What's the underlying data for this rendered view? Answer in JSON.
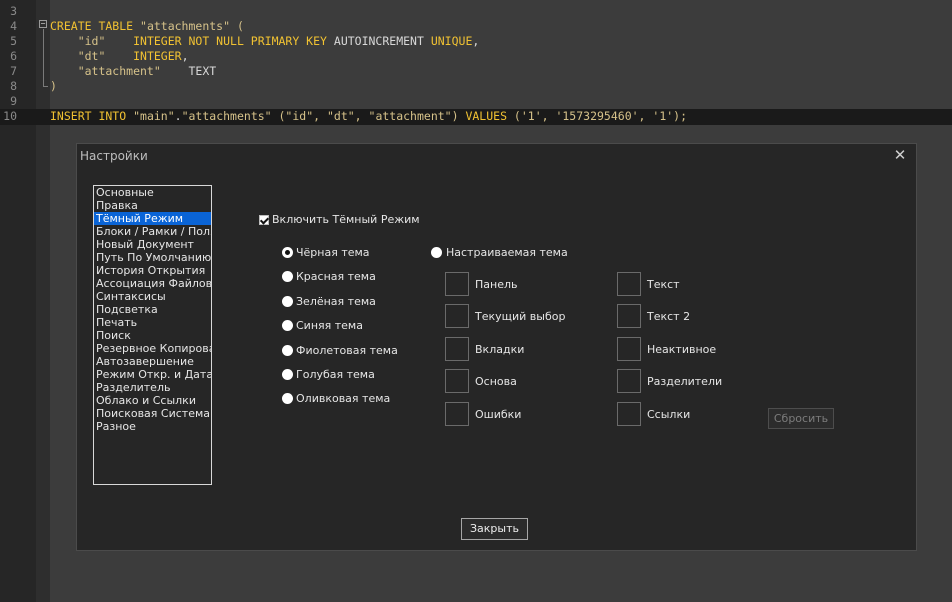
{
  "editor": {
    "lines": [
      {
        "num": "3"
      },
      {
        "num": "4",
        "tokens": [
          {
            "t": "CREATE TABLE ",
            "c": "kw"
          },
          {
            "t": "\"attachments\" (",
            "c": "str"
          }
        ]
      },
      {
        "num": "5",
        "tokens": [
          {
            "t": "    \"id\"    ",
            "c": "str"
          },
          {
            "t": "INTEGER NOT NULL PRIMARY KEY ",
            "c": "kw"
          },
          {
            "t": "AUTOINCREMENT ",
            "c": "txt"
          },
          {
            "t": "UNIQUE",
            "c": "kw"
          },
          {
            "t": ",",
            "c": "txt"
          }
        ]
      },
      {
        "num": "6",
        "tokens": [
          {
            "t": "    \"dt\"    ",
            "c": "str"
          },
          {
            "t": "INTEGER",
            "c": "kw"
          },
          {
            "t": ",",
            "c": "txt"
          }
        ]
      },
      {
        "num": "7",
        "tokens": [
          {
            "t": "    \"attachment\"    ",
            "c": "str"
          },
          {
            "t": "TEXT",
            "c": "txt"
          }
        ]
      },
      {
        "num": "8",
        "tokens": [
          {
            "t": ")",
            "c": "str"
          }
        ]
      },
      {
        "num": "9"
      },
      {
        "num": "10",
        "current": true,
        "tokens": [
          {
            "t": "INSERT INTO ",
            "c": "kw"
          },
          {
            "t": "\"main\"",
            "c": "str"
          },
          {
            "t": ".",
            "c": "txt"
          },
          {
            "t": "\"attachments\" (\"id\", \"dt\", \"attachment\") ",
            "c": "str"
          },
          {
            "t": "VALUES ",
            "c": "kw"
          },
          {
            "t": "('1', '1573295460', '1');",
            "c": "str"
          }
        ]
      }
    ]
  },
  "dialog": {
    "title": "Настройки",
    "close_glyph": "✕",
    "categories": [
      "Основные",
      "Правка",
      "Тёмный Режим",
      "Блоки / Рамки / Поля",
      "Новый Документ",
      "Путь По Умолчанию",
      "История Открытия",
      "Ассоциация Файлов",
      "Синтаксисы",
      "Подсветка",
      "Печать",
      "Поиск",
      "Резервное Копирование",
      "Автозавершение",
      "Режим Откр. и Дата",
      "Разделитель",
      "Облако и Ссылки",
      "Поисковая Система",
      "Разное"
    ],
    "selected_category": "Тёмный Режим",
    "enable_dark_label": "Включить Тёмный Режим",
    "enable_dark_checked": true,
    "themes": [
      {
        "label": "Чёрная тема",
        "selected": true
      },
      {
        "label": "Красная тема",
        "selected": false
      },
      {
        "label": "Зелёная тема",
        "selected": false
      },
      {
        "label": "Синяя тема",
        "selected": false
      },
      {
        "label": "Фиолетовая тема",
        "selected": false
      },
      {
        "label": "Голубая тема",
        "selected": false
      },
      {
        "label": "Оливковая тема",
        "selected": false
      }
    ],
    "custom_theme_label": "Настраиваемая тема",
    "custom_theme_selected": false,
    "color_slots_left": [
      "Панель",
      "Текущий выбор",
      "Вкладки",
      "Основа",
      "Ошибки"
    ],
    "color_slots_right": [
      "Текст",
      "Текст 2",
      "Неактивное",
      "Разделители",
      "Ссылки"
    ],
    "reset_label": "Сбросить",
    "close_label": "Закрыть"
  }
}
